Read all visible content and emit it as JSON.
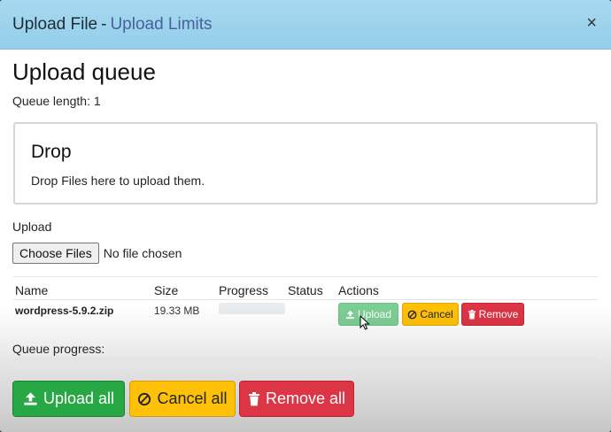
{
  "header": {
    "title": "Upload File",
    "separator": "-",
    "link": "Upload Limits",
    "close_glyph": "×"
  },
  "queue": {
    "heading": "Upload queue",
    "length_text": "Queue length: 1"
  },
  "drop": {
    "title": "Drop",
    "text": "Drop Files here to upload them."
  },
  "upload_input": {
    "label": "Upload",
    "button": "Choose Files",
    "status": "No file chosen"
  },
  "table": {
    "columns": [
      "Name",
      "Size",
      "Progress",
      "Status",
      "Actions"
    ],
    "rows": [
      {
        "name": "wordpress-5.9.2.zip",
        "size": "19.33 MB",
        "progress": 0,
        "status": "",
        "actions": {
          "upload": "Upload",
          "cancel": "Cancel",
          "remove": "Remove"
        }
      }
    ]
  },
  "queue_progress": {
    "label": "Queue progress:",
    "value": 0
  },
  "footer": {
    "upload_all": "Upload all",
    "cancel_all": "Cancel all",
    "remove_all": "Remove all"
  },
  "colors": {
    "header_bg": "#a7d8ef",
    "success": "#28a745",
    "warning": "#ffc107",
    "danger": "#dc3545"
  },
  "icons": [
    "upload-icon",
    "ban-icon",
    "trash-icon",
    "close-icon",
    "mouse-cursor-icon"
  ]
}
